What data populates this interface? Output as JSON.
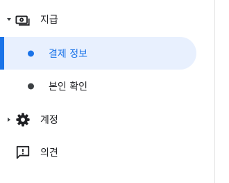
{
  "nav": {
    "items": [
      {
        "label": "지급",
        "icon": "payments-icon",
        "expanded": true
      },
      {
        "label": "결제 정보",
        "selected": true
      },
      {
        "label": "본인 확인"
      },
      {
        "label": "계정",
        "icon": "gear-icon",
        "expanded": false
      },
      {
        "label": "의견",
        "icon": "feedback-icon"
      }
    ]
  },
  "colors": {
    "accent": "#1a73e8",
    "selected_bg": "#e8f0fe",
    "text": "#202124"
  }
}
